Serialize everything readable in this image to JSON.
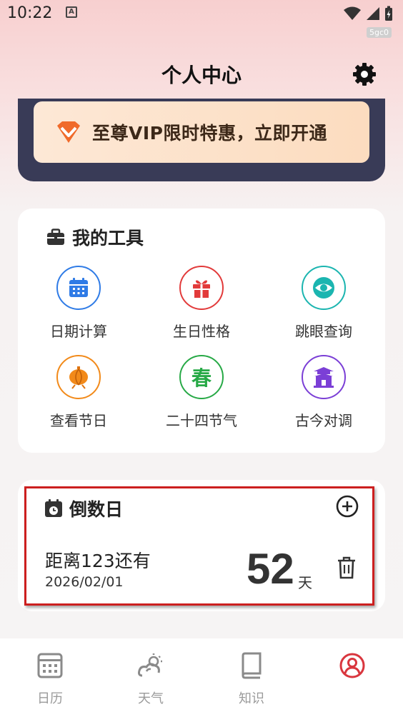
{
  "status_bar": {
    "time": "10:22",
    "app_badge": "A",
    "device_tag": "5gc0"
  },
  "header": {
    "title": "个人中心"
  },
  "vip": {
    "text": "至尊VIP限时特惠，立即开通"
  },
  "tools": {
    "title": "我的工具",
    "items": [
      {
        "label": "日期计算",
        "icon": "calendar-icon",
        "color": "#2f7be6"
      },
      {
        "label": "生日性格",
        "icon": "gift-icon",
        "color": "#e23a3a"
      },
      {
        "label": "跳眼查询",
        "icon": "eye-icon",
        "color": "#1bb5b0"
      },
      {
        "label": "查看节日",
        "icon": "lantern-icon",
        "color": "#f28a1a"
      },
      {
        "label": "二十四节气",
        "icon": "spring-icon",
        "glyph": "春",
        "color": "#27a946"
      },
      {
        "label": "古今对调",
        "icon": "pavilion-icon",
        "color": "#7b3fd6"
      }
    ]
  },
  "countdown": {
    "title": "倒数日",
    "event_name": "距离123还有",
    "event_date": "2026/02/01",
    "days": "52",
    "days_unit": "天"
  },
  "nav": {
    "items": [
      {
        "label": "日历",
        "icon": "calendar-icon"
      },
      {
        "label": "天气",
        "icon": "weather-icon"
      },
      {
        "label": "知识",
        "icon": "book-icon"
      },
      {
        "label": "",
        "icon": "user-icon",
        "active": true
      }
    ],
    "active_color": "#d9363e",
    "inactive_color": "#9a9a9a"
  }
}
